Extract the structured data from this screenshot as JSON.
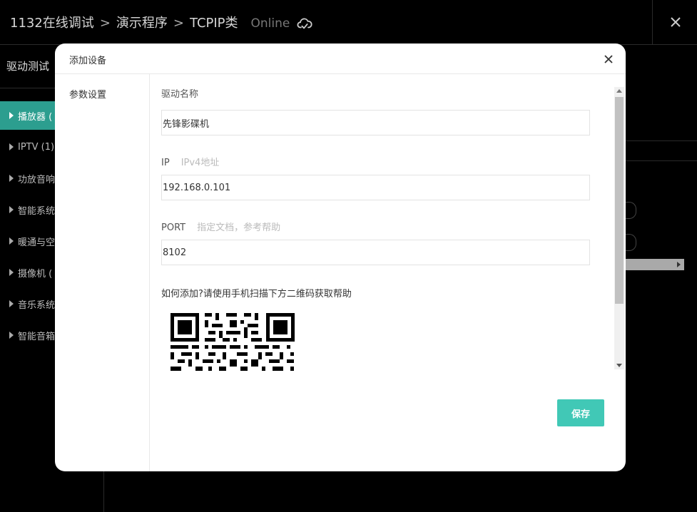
{
  "header": {
    "breadcrumb": [
      "1132在线调试",
      "演示程序",
      "TCPIP类"
    ],
    "separator": ">",
    "status": "Online",
    "cloud_icon": "cloud-sync-icon",
    "close_icon": "close-icon"
  },
  "sidebar": {
    "title": "驱动测试",
    "items": [
      {
        "label": "播放器 (",
        "active": true
      },
      {
        "label": "IPTV (1)",
        "active": false
      },
      {
        "label": "功放音响",
        "active": false
      },
      {
        "label": "智能系统",
        "active": false
      },
      {
        "label": "暖通与空",
        "active": false
      },
      {
        "label": "摄像机 (",
        "active": false
      },
      {
        "label": "音乐系统",
        "active": false
      },
      {
        "label": "智能音箱",
        "active": false
      }
    ]
  },
  "modal": {
    "title": "添加设备",
    "nav": {
      "item": "参数设置"
    },
    "fields": {
      "driver_name": {
        "label": "驱动名称",
        "value": "先锋影碟机"
      },
      "ip": {
        "label": "IP",
        "hint": "IPv4地址",
        "value": "192.168.0.101"
      },
      "port": {
        "label": "PORT",
        "hint": "指定文档，参考帮助",
        "value": "8102"
      }
    },
    "help_text": "如何添加?请使用手机扫描下方二维码获取帮助",
    "save_label": "保存"
  },
  "colors": {
    "accent": "#41c8b6",
    "active_item": "#2c9e8f",
    "background": "#000000"
  }
}
